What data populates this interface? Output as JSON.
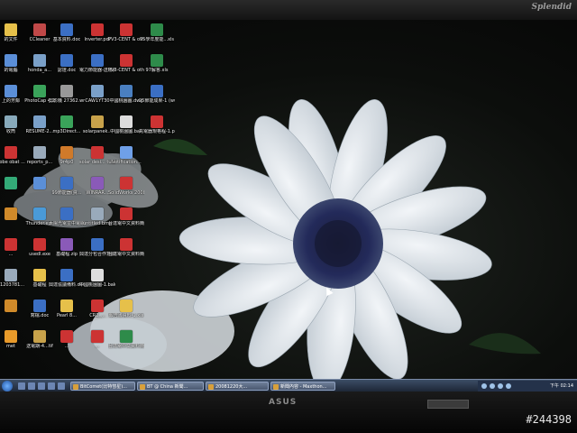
{
  "monitor": {
    "brand_top": "Splendid",
    "brand_bottom": "ASUS",
    "badge": "",
    "watermark": "#244398"
  },
  "desktop": {
    "icons": [
      {
        "label": "的文件",
        "color": "#e6c04a",
        "icon": "folder-icon"
      },
      {
        "label": "CCleaner",
        "color": "#c04848",
        "icon": "ccleaner-icon"
      },
      {
        "label": "基本資料.doc",
        "color": "#3b6fc4",
        "icon": "word-doc-icon"
      },
      {
        "label": "Inverter.pdf",
        "color": "#c33",
        "icon": "pdf-icon"
      },
      {
        "label": "PV3-CENT & other (...",
        "color": "#c33",
        "icon": "pdf-icon"
      },
      {
        "label": "95學年度能...xls",
        "color": "#2e8b4a",
        "icon": "excel-icon"
      },
      {
        "label": "的電腦",
        "color": "#5b8fd8",
        "icon": "computer-icon"
      },
      {
        "label": "honda_a...",
        "color": "#7aa0c8",
        "icon": "file-icon"
      },
      {
        "label": "認證.doc",
        "color": "#3b6fc4",
        "icon": "word-doc-icon"
      },
      {
        "label": "電力節能器-送審資料...",
        "color": "#3b6fc4",
        "icon": "word-doc-icon"
      },
      {
        "label": "PV3-CENT & other (...",
        "color": "#c33",
        "icon": "pdf-icon"
      },
      {
        "label": "97解答.xls",
        "color": "#2e8b4a",
        "icon": "excel-icon"
      },
      {
        "label": "上的芳鄰",
        "color": "#5b8fd8",
        "icon": "network-icon"
      },
      {
        "label": "PhotoCap 4.2",
        "color": "#3aa35a",
        "icon": "photocap-icon"
      },
      {
        "label": "剪影機 27362.wma",
        "color": "#999",
        "icon": "media-icon"
      },
      {
        "label": "CAW1YT30",
        "color": "#7aa0c8",
        "icon": "file-icon"
      },
      {
        "label": "中國桃園圖.dwg",
        "color": "#4a7fc0",
        "icon": "dwg-icon"
      },
      {
        "label": "95節能成果-1 (www...",
        "color": "#3b6fc4",
        "icon": "word-doc-icon"
      },
      {
        "label": "收筒",
        "color": "#8ab",
        "icon": "recycle-bin-icon"
      },
      {
        "label": "RESUME-2...",
        "color": "#7aa0c8",
        "icon": "file-icon"
      },
      {
        "label": "mp3Direct...",
        "color": "#3aa35a",
        "icon": "mp3-icon"
      },
      {
        "label": "solarpanek...",
        "color": "#c8a24a",
        "icon": "file-icon"
      },
      {
        "label": "中國桃園圖.bak",
        "color": "#ddd",
        "icon": "text-file-icon"
      },
      {
        "label": "充電器規格程-1.pdf",
        "color": "#c33",
        "icon": "pdf-icon"
      },
      {
        "label": "dobe obat ...",
        "color": "#c33",
        "icon": "adobe-icon"
      },
      {
        "label": "reports_p...",
        "color": "#9ab",
        "icon": "file-icon"
      },
      {
        "label": "9r4p0",
        "color": "#d07a2a",
        "icon": "file-icon"
      },
      {
        "label": "solar desi... tution.pdf",
        "color": "#c33",
        "icon": "pdf-icon"
      },
      {
        "label": "Notification...",
        "color": "#6fa0e8",
        "icon": "file-icon"
      },
      {
        "label": "",
        "color": "#3a7",
        "icon": "app-icon"
      },
      {
        "label": "",
        "color": "#5b8fd8",
        "icon": "app-icon"
      },
      {
        "label": "99節能器(資...",
        "color": "#3b6fc4",
        "icon": "word-doc-icon"
      },
      {
        "label": "WINRAR...",
        "color": "#8a5ab8",
        "icon": "winrar-icon"
      },
      {
        "label": "SolidWorks 2008 SP0.0",
        "color": "#c33",
        "icon": "solidworks-icon"
      },
      {
        "label": "",
        "color": "#d08a2a",
        "icon": "app-icon"
      },
      {
        "label": "Thunder.exe",
        "color": "#4a9ad8",
        "icon": "thunder-icon"
      },
      {
        "label": "太陽光電並中電網...",
        "color": "#3b6fc4",
        "icon": "word-doc-icon"
      },
      {
        "label": "untitled.bmp",
        "color": "#9ab",
        "icon": "image-icon"
      },
      {
        "label": "台達電中文資料簡-1.pdf",
        "color": "#c33",
        "icon": "pdf-icon"
      },
      {
        "label": "...",
        "color": "#c33",
        "icon": "app-icon"
      },
      {
        "label": "usedl.exe",
        "color": "#c33",
        "icon": "exe-icon"
      },
      {
        "label": "基礎程.zip",
        "color": "#8a5ab8",
        "icon": "winrar-icon"
      },
      {
        "label": "興達分包合作意願書...",
        "color": "#3b6fc4",
        "icon": "word-doc-icon"
      },
      {
        "label": "台達電中文資料簡-1.pdf",
        "color": "#c33",
        "icon": "pdf-icon"
      },
      {
        "label": "Y1203781...",
        "color": "#9ab",
        "icon": "file-icon"
      },
      {
        "label": "基礎程",
        "color": "#e6c04a",
        "icon": "folder-icon"
      },
      {
        "label": "興達協議備料.doc",
        "color": "#3b6fc4",
        "icon": "word-doc-icon"
      },
      {
        "label": "中國桃園圖-1.bak",
        "color": "#ddd",
        "icon": "text-file-icon"
      },
      {
        "label": "",
        "color": "#d08a2a",
        "icon": "app-icon"
      },
      {
        "label": "寫檔.doc",
        "color": "#3b6fc4",
        "icon": "word-doc-icon"
      },
      {
        "label": "Pearl 8...",
        "color": "#e6c04a",
        "icon": "folder-icon"
      },
      {
        "label": "CR2_...",
        "color": "#c33",
        "icon": "pdf-icon"
      },
      {
        "label": "報告書資料-1.xls",
        "color": "#e6c04a",
        "icon": "folder-icon"
      },
      {
        "label": "met",
        "color": "#e89a2a",
        "icon": "app-icon"
      },
      {
        "label": "送電期-4...tif",
        "color": "#c8a24a",
        "icon": "image-icon"
      },
      {
        "label": "...",
        "color": "#c33",
        "icon": "pdf-icon"
      },
      {
        "label": "...",
        "color": "#c33",
        "icon": "pdf-icon"
      },
      {
        "label": "台達電中文資料簡-1.pdf",
        "color": "#2e8b4a",
        "icon": "excel-icon"
      }
    ]
  },
  "taskbar": {
    "tasks": [
      {
        "label": "BitComet(比特彗星)..."
      },
      {
        "label": "BT @ China 新聞..."
      },
      {
        "label": "20081220大..."
      },
      {
        "label": "新聞內容 - Maxthon..."
      }
    ],
    "clock": "下午 02:14"
  }
}
